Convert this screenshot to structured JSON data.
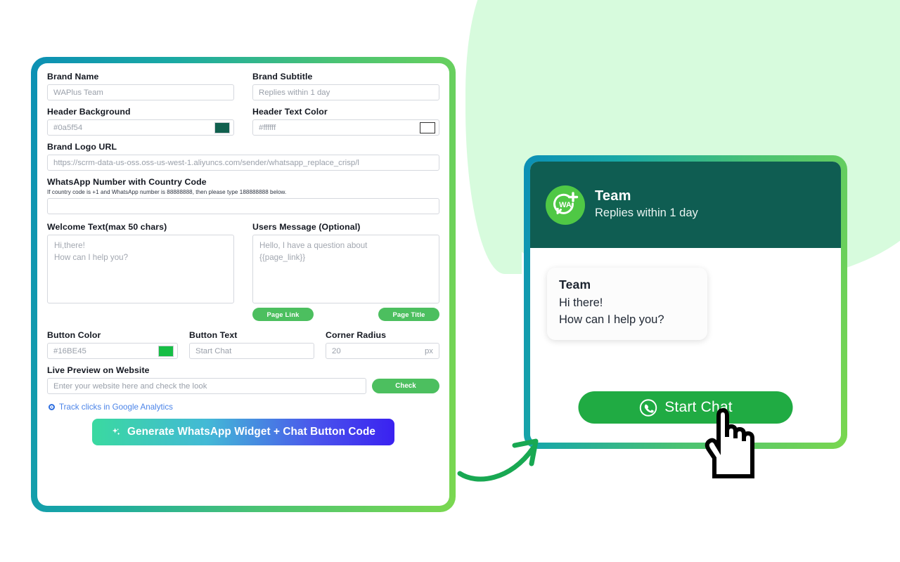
{
  "form": {
    "brand_name": {
      "label": "Brand Name",
      "placeholder": "WAPlus Team"
    },
    "brand_subtitle": {
      "label": "Brand Subtitle",
      "placeholder": "Replies within 1 day"
    },
    "header_background": {
      "label": "Header Background",
      "placeholder": "#0a5f54",
      "color": "#0a5f54"
    },
    "header_text_color": {
      "label": "Header Text Color",
      "placeholder": "#ffffff",
      "color": "#ffffff"
    },
    "brand_logo_url": {
      "label": "Brand Logo URL",
      "placeholder": "https://scrm-data-us-oss.oss-us-west-1.aliyuncs.com/sender/whatsapp_replace_crisp/l"
    },
    "whatsapp_number": {
      "label": "WhatsApp Number with Country Code",
      "hint": "If country code is +1 and WhatsApp number is 88888888, then please type 188888888 below.",
      "value": ""
    },
    "welcome_text": {
      "label": "Welcome Text(max 50 chars)",
      "placeholder_line1": "Hi,there!",
      "placeholder_line2": "How can I help you?"
    },
    "users_message": {
      "label": "Users Message (Optional)",
      "placeholder_line1": "Hello, I have a question about",
      "placeholder_line2": "{{page_link}}",
      "chip_page_link": "Page Link",
      "chip_page_title": "Page Title"
    },
    "button_color": {
      "label": "Button Color",
      "placeholder": "#16BE45",
      "color": "#16BE45"
    },
    "button_text": {
      "label": "Button Text",
      "placeholder": "Start Chat"
    },
    "corner_radius": {
      "label": "Corner Radius",
      "placeholder": "20",
      "unit": "px"
    },
    "live_preview": {
      "label": "Live Preview on Website",
      "placeholder": "Enter your website here and check the look",
      "check_label": "Check"
    },
    "track_analytics_label": "Track clicks in Google Analytics",
    "generate_label": "Generate WhatsApp Widget + Chat Button Code"
  },
  "preview": {
    "header": {
      "title": "Team",
      "subtitle": "Replies within 1 day",
      "background": "#0f5d52",
      "avatar_text": "WA"
    },
    "bubble": {
      "name": "Team",
      "line1": "Hi there!",
      "line2": "How can I help you?"
    },
    "start_button": {
      "label": "Start Chat",
      "color": "#20ab43"
    }
  },
  "theme": {
    "gradient_start": "#0b8fb6",
    "gradient_end": "#7ad74f",
    "mint_blob": "#d7fbdd",
    "arrow_color": "#18a852",
    "generate_gradient_start": "#3ad9a0",
    "generate_gradient_end": "#3a21f0"
  }
}
